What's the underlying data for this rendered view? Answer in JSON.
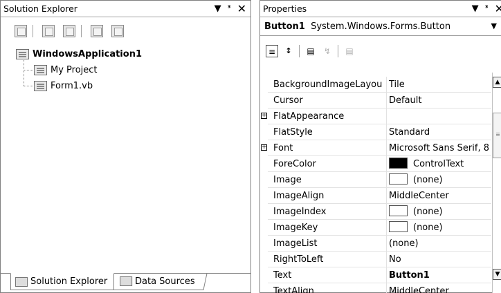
{
  "solution_explorer": {
    "title": "Solution Explorer",
    "title_icons": [
      "dropdown-arrow-icon",
      "pin-icon",
      "close-icon"
    ],
    "tree": {
      "root": "WindowsApplication1",
      "children": [
        "My Project",
        "Form1.vb"
      ]
    },
    "tabs": {
      "active": "Solution Explorer",
      "inactive": "Data Sources"
    }
  },
  "properties": {
    "title": "Properties",
    "object": {
      "name": "Button1",
      "type": "System.Windows.Forms.Button"
    },
    "rows": [
      {
        "name": "BackgroundImageLayou",
        "value": "Tile"
      },
      {
        "name": "Cursor",
        "value": "Default"
      },
      {
        "name": "FlatAppearance",
        "value": "",
        "expandable": true
      },
      {
        "name": "FlatStyle",
        "value": "Standard"
      },
      {
        "name": "Font",
        "value": "Microsoft Sans Serif, 8",
        "expandable": true
      },
      {
        "name": "ForeColor",
        "value": "ControlText",
        "swatch": "#000000"
      },
      {
        "name": "Image",
        "value": "(none)",
        "swatch": "#ffffff"
      },
      {
        "name": "ImageAlign",
        "value": "MiddleCenter"
      },
      {
        "name": "ImageIndex",
        "value": "(none)",
        "swatch": "#ffffff"
      },
      {
        "name": "ImageKey",
        "value": "(none)",
        "swatch": "#ffffff"
      },
      {
        "name": "ImageList",
        "value": "(none)"
      },
      {
        "name": "RightToLeft",
        "value": "No"
      },
      {
        "name": "Text",
        "value": "Button1",
        "bold": true
      },
      {
        "name": "TextAlign",
        "value": "MiddleCenter"
      }
    ]
  }
}
